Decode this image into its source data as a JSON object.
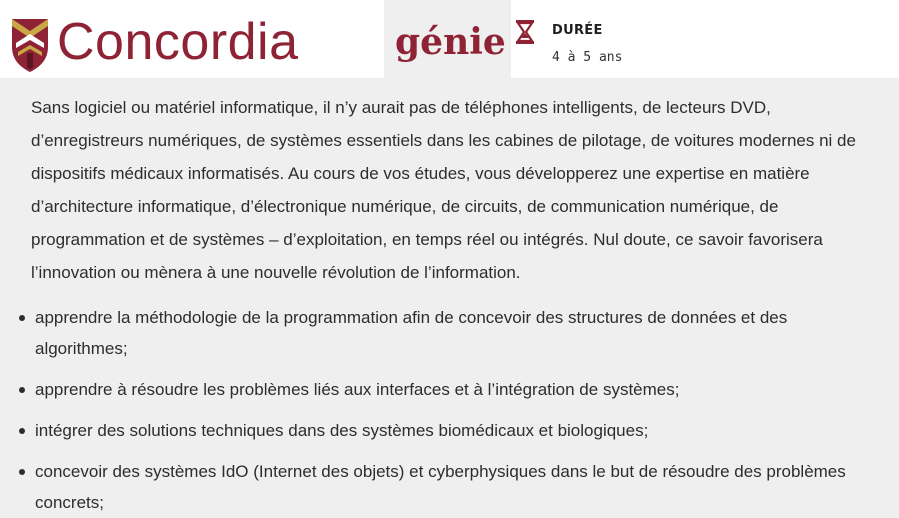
{
  "header": {
    "brand": "Concordia",
    "department": "génie",
    "duration": {
      "label": "DURÉE",
      "value": "4 à 5 ans",
      "icon": "hourglass-icon"
    },
    "colors": {
      "brand": "#8e2335",
      "gold": "#c9a646"
    }
  },
  "intro": "Sans logiciel ou matériel informatique, il n’y aurait pas de téléphones intelligents, de lecteurs DVD, d’enregistreurs numériques, de systèmes essentiels dans les cabines de pilotage, de voitures modernes ni de dispositifs médicaux informatisés. Au cours de vos études, vous développerez une expertise en matière d’architecture informatique, d’électronique numérique, de circuits, de communication numérique, de programmation et de systèmes – d’exploitation, en temps réel ou intégrés. Nul doute, ce savoir favorisera l’innovation ou mènera à une nouvelle révolution de l’information.",
  "skills": [
    "apprendre la méthodologie de la programmation afin de concevoir des structures de données et des algorithmes;",
    "apprendre à résoudre les problèmes liés aux interfaces et à l’intégration de systèmes;",
    "intégrer des solutions techniques dans des systèmes biomédicaux et biologiques;",
    "concevoir des systèmes IdO (Internet des objets) et cyberphysiques dans le but de résoudre des problèmes concrets;"
  ]
}
